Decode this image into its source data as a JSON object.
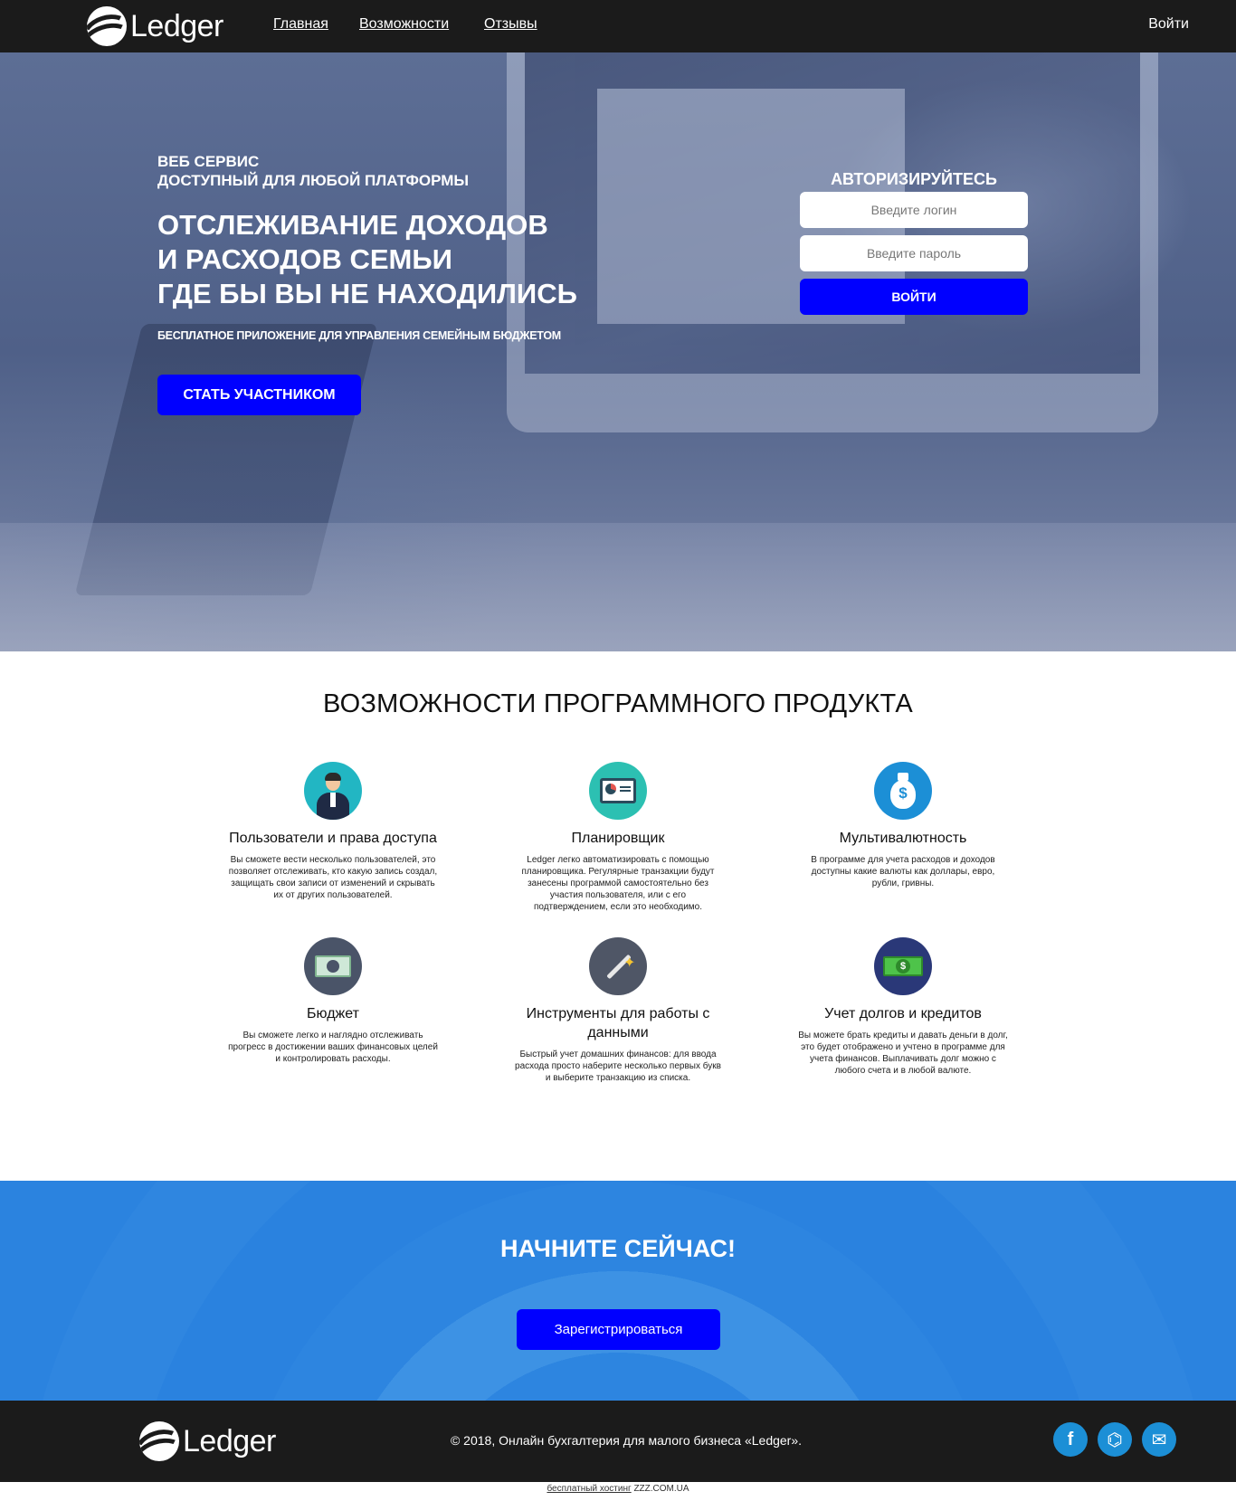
{
  "header": {
    "brand": "Ledger",
    "nav": [
      {
        "label": "Главная"
      },
      {
        "label": "Возможности"
      },
      {
        "label": "Отзывы"
      }
    ],
    "login": "Войти"
  },
  "hero": {
    "kicker_line1": "ВЕБ СЕРВИС",
    "kicker_line2": "ДОСТУПНЫЙ ДЛЯ ЛЮБОЙ ПЛАТФОРМЫ",
    "title_line1": "ОТСЛЕЖИВАНИЕ ДОХОДОВ",
    "title_line2": "И РАСХОДОВ СЕМЬИ",
    "title_line3": "ГДЕ БЫ ВЫ НЕ НАХОДИЛИСЬ",
    "subtitle": "БЕСПЛАТНОЕ ПРИЛОЖЕНИЕ ДЛЯ УПРАВЛЕНИЯ СЕМЕЙНЫМ БЮДЖЕТОМ",
    "cta": "СТАТЬ УЧАСТНИКОМ"
  },
  "auth": {
    "title": "АВТОРИЗИРУЙТЕСЬ",
    "login_placeholder": "Введите логин",
    "login_value": "",
    "password_placeholder": "Введите пароль",
    "password_value": "",
    "submit": "ВОЙТИ"
  },
  "features": {
    "title": "ВОЗМОЖНОСТИ ПРОГРАММНОГО ПРОДУКТА",
    "items": [
      {
        "icon": "user-icon",
        "title": "Пользователи и права доступа",
        "desc": "Вы сможете вести несколько пользователей, это позволяет отслеживать, кто какую запись создал, защищать свои записи от изменений и скрывать их от других пользователей."
      },
      {
        "icon": "planner-icon",
        "title": "Планировщик",
        "desc": "Ledger легко автоматизировать с помощью планировщика. Регулярные транзакции будут занесены программой самостоятельно без участия пользователя, или с его подтверждением, если это необходимо."
      },
      {
        "icon": "money-bag-icon",
        "title": "Мультивалютность",
        "desc": "В программе для учета расходов и доходов доступны какие валюты как доллары, евро, рубли, гривны."
      },
      {
        "icon": "banknote-icon",
        "title": "Бюджет",
        "desc": "Вы сможете легко и наглядно отслеживать прогресс в достижении ваших финансовых целей и контролировать расходы."
      },
      {
        "icon": "magic-wand-icon",
        "title": "Инструменты для работы с данными",
        "desc": "Быстрый учет домашних финансов: для ввода расхода просто наберите несколько первых букв и выберите транзакцию из списка."
      },
      {
        "icon": "dollar-bill-icon",
        "title": "Учет долгов и кредитов",
        "desc": "Вы можете брать кредиты и давать деньги в долг, это будет отображено и учтено в программе для учета финансов. Выплачивать долг можно с любого счета и в любой валюте."
      }
    ]
  },
  "cta_band": {
    "title": "НАЧНИТЕ СЕЙЧАС!",
    "button": "Зарегистрироваться"
  },
  "footer": {
    "brand": "Ledger",
    "copyright": "© 2018, Онлайн бухгалтерия для малого бизнеса «Ledger».",
    "social": [
      {
        "icon": "facebook-icon",
        "glyph": "f"
      },
      {
        "icon": "github-icon",
        "glyph": "⌬"
      },
      {
        "icon": "mail-icon",
        "glyph": "✉"
      }
    ],
    "hosting_link": "бесплатный хостинг",
    "hosting_domain": "ZZZ.COM.UA"
  },
  "colors": {
    "accent_button": "#0000ff",
    "header_bg": "#1b1b1b",
    "cta_band_bg": "#2d85e0",
    "social_bg": "#1c8fd6"
  }
}
